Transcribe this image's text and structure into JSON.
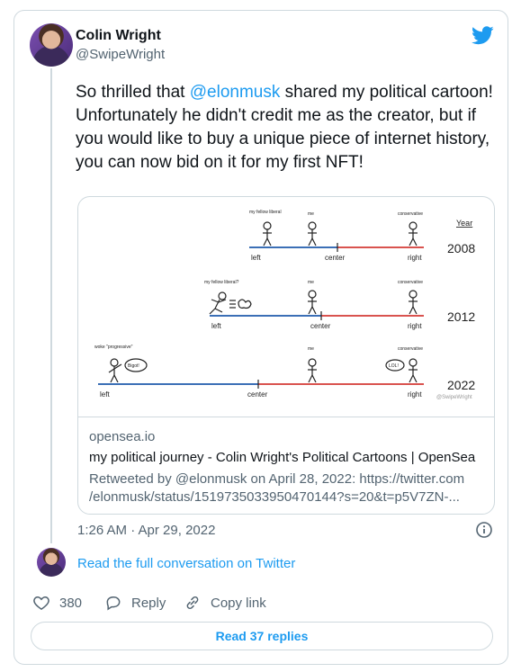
{
  "author": {
    "name": "Colin Wright",
    "handle": "@SwipeWright"
  },
  "tweet": {
    "text_before": "So thrilled that ",
    "mention": "@elonmusk",
    "text_after": " shared my political cartoon! Unfortunately he didn't credit me as the creator, but if you would like to buy a unique piece of internet history, you can now bid on it for my first NFT!"
  },
  "cartoon": {
    "year_header": "Year",
    "watermark": "@SwipeWright",
    "rows": [
      {
        "year": "2008",
        "axis": {
          "left": "left",
          "center": "center",
          "right": "right"
        },
        "figures": [
          {
            "label": "my fellow liberal"
          },
          {
            "label": "me"
          },
          {
            "label": "conservative"
          }
        ]
      },
      {
        "year": "2012",
        "axis": {
          "left": "left",
          "center": "center",
          "right": "right"
        },
        "figures": [
          {
            "label": "my fellow liberal?"
          },
          {
            "label": "me"
          },
          {
            "label": "conservative"
          }
        ]
      },
      {
        "year": "2022",
        "axis": {
          "left": "left",
          "center": "center",
          "right": "right"
        },
        "figures": [
          {
            "label": "woke \"progressive\"",
            "bubble": "Bigot!"
          },
          {
            "label": "me"
          },
          {
            "label": "conservative",
            "bubble": "LOL!"
          }
        ]
      }
    ]
  },
  "link_card": {
    "domain": "opensea.io",
    "title": "my political journey - Colin Wright's Political Cartoons | OpenSea",
    "desc_line1": "Retweeted by @elonmusk on April 28, 2022: https://twitter.com",
    "desc_line2": "/elonmusk/status/1519735033950470144?s=20&t=p5V7ZN-..."
  },
  "timestamp": "1:26 AM · Apr 29, 2022",
  "read_full": "Read the full conversation on Twitter",
  "actions": {
    "like_count": "380",
    "reply_label": "Reply",
    "copy_label": "Copy link"
  },
  "read_replies": "Read 37 replies",
  "colors": {
    "accent": "#1d9bf0",
    "left_axis": "#3b6fb6",
    "right_axis": "#d9534f"
  },
  "icons": [
    "twitter-bird-icon",
    "info-icon",
    "heart-icon",
    "reply-icon",
    "link-icon"
  ]
}
